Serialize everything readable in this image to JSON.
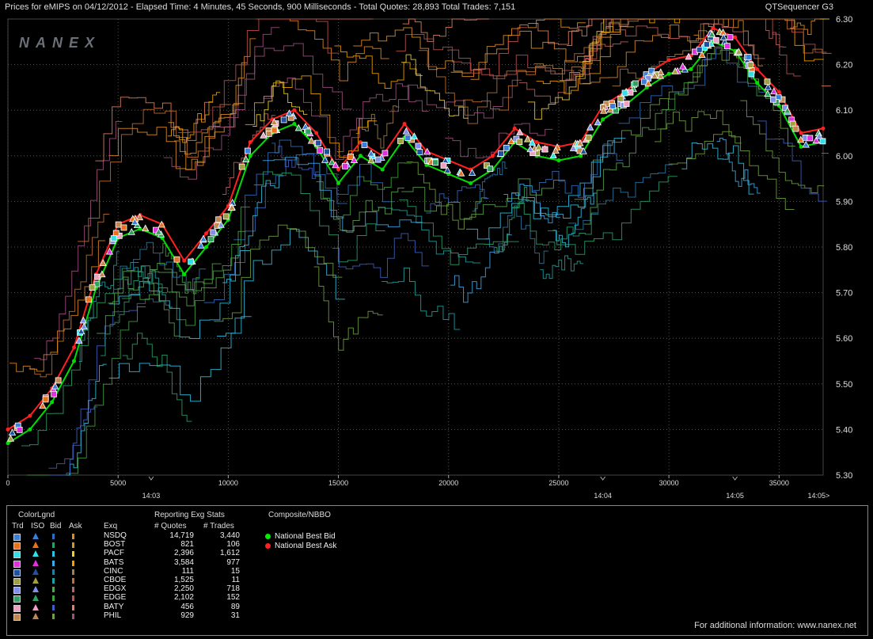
{
  "header": {
    "title": "Prices for  eMIPS  on  04/12/2012  -  Elapsed Time: 4 Minutes, 45 Seconds, 900 Milliseconds  -  Total Quotes: 28,893  Total Trades: 7,151",
    "app": "QTSequencer G3"
  },
  "watermark": "NANEX",
  "chart_data": {
    "type": "line",
    "title": "",
    "xlabel": "",
    "ylabel": "",
    "xlim": [
      0,
      37000
    ],
    "ylim": [
      5.3,
      6.3
    ],
    "x_ticks": [
      "0",
      "5000",
      "10000",
      "15000",
      "20000",
      "25000",
      "30000",
      "35000"
    ],
    "x_tick_values": [
      0,
      5000,
      10000,
      15000,
      20000,
      25000,
      30000,
      35000
    ],
    "y_ticks": [
      "6.30",
      "6.20",
      "6.10",
      "6.00",
      "5.90",
      "5.80",
      "5.70",
      "5.60",
      "5.50",
      "5.40",
      "5.30"
    ],
    "y_tick_values": [
      6.3,
      6.2,
      6.1,
      6.0,
      5.9,
      5.8,
      5.7,
      5.6,
      5.5,
      5.4,
      5.3
    ],
    "time_markers": [
      {
        "label": "14:03",
        "x": 6500
      },
      {
        "label": "14:04",
        "x": 27000
      },
      {
        "label": "14:05",
        "x": 33000
      },
      {
        "label": "14:05>",
        "x": 36800
      }
    ],
    "grid": true,
    "series": [
      {
        "name": "National Best Bid",
        "color": "#00dd00",
        "x": [
          0,
          1000,
          2000,
          3000,
          4000,
          5000,
          6000,
          7000,
          8000,
          9000,
          10000,
          11000,
          12000,
          13000,
          14000,
          15000,
          16000,
          17000,
          18000,
          19000,
          20000,
          21000,
          22000,
          23000,
          24000,
          25000,
          26000,
          27000,
          28000,
          29000,
          30000,
          31000,
          32000,
          33000,
          34000,
          35000,
          36000,
          37000
        ],
        "values": [
          5.37,
          5.4,
          5.46,
          5.55,
          5.71,
          5.82,
          5.84,
          5.82,
          5.74,
          5.8,
          5.86,
          6.0,
          6.05,
          6.07,
          6.02,
          5.94,
          6.0,
          5.97,
          6.04,
          5.98,
          5.96,
          5.94,
          5.97,
          6.03,
          6.0,
          5.99,
          6.0,
          6.08,
          6.11,
          6.15,
          6.18,
          6.19,
          6.25,
          6.23,
          6.16,
          6.11,
          6.02,
          6.03
        ]
      },
      {
        "name": "National Best Ask",
        "color": "#ff2020",
        "x": [
          0,
          1000,
          2000,
          3000,
          4000,
          5000,
          6000,
          7000,
          8000,
          9000,
          10000,
          11000,
          12000,
          13000,
          14000,
          15000,
          16000,
          17000,
          18000,
          19000,
          20000,
          21000,
          22000,
          23000,
          24000,
          25000,
          26000,
          27000,
          28000,
          29000,
          30000,
          31000,
          32000,
          33000,
          34000,
          35000,
          36000,
          37000
        ],
        "values": [
          5.4,
          5.43,
          5.49,
          5.58,
          5.74,
          5.85,
          5.87,
          5.85,
          5.77,
          5.83,
          5.89,
          6.03,
          6.08,
          6.1,
          6.05,
          5.97,
          6.03,
          6.0,
          6.07,
          6.01,
          5.99,
          5.97,
          6.0,
          6.06,
          6.03,
          6.02,
          6.03,
          6.11,
          6.14,
          6.18,
          6.21,
          6.22,
          6.28,
          6.26,
          6.19,
          6.14,
          6.05,
          6.06
        ]
      }
    ]
  },
  "legend": {
    "colorlgnd_title": "ColorLgnd",
    "stats_title": "Reporting Exg Stats",
    "composite_title": "Composite/NBBO",
    "col_trd": "Trd",
    "col_iso": "ISO",
    "col_bid": "Bid",
    "col_ask": "Ask",
    "col_exq": "Exq",
    "col_quotes": "# Quotes",
    "col_trades": "# Trades",
    "exchanges": [
      {
        "name": "NSDQ",
        "quotes": "14,719",
        "trades": "3,440",
        "trd": "#3a7fd8",
        "iso": "#3a7fd8",
        "bid": "#2f6fc0",
        "ask": "#e08a20"
      },
      {
        "name": "BOST",
        "quotes": "821",
        "trades": "106",
        "trd": "#e8701e",
        "iso": "#e8701e",
        "bid": "#2aa06a",
        "ask": "#e0902a"
      },
      {
        "name": "PACF",
        "quotes": "2,396",
        "trades": "1,612",
        "trd": "#30e0e8",
        "iso": "#30e0e8",
        "bid": "#30c0e0",
        "ask": "#f0d030"
      },
      {
        "name": "BATS",
        "quotes": "3,584",
        "trades": "977",
        "trd": "#e030e0",
        "iso": "#e030e0",
        "bid": "#40a8e8",
        "ask": "#f0a000"
      },
      {
        "name": "CINC",
        "quotes": "111",
        "trades": "15",
        "trd": "#2050a0",
        "iso": "#2050a0",
        "bid": "#2a7aa8",
        "ask": "#a08050"
      },
      {
        "name": "CBOE",
        "quotes": "1,525",
        "trades": "11",
        "trd": "#a0a040",
        "iso": "#a0a040",
        "bid": "#20a0a0",
        "ask": "#c07030"
      },
      {
        "name": "EDGX",
        "quotes": "2,250",
        "trades": "718",
        "trd": "#8090e8",
        "iso": "#8090e8",
        "bid": "#5aa050",
        "ask": "#c06060"
      },
      {
        "name": "EDGE",
        "quotes": "2,102",
        "trades": "152",
        "trd": "#30a060",
        "iso": "#30a060",
        "bid": "#40a040",
        "ask": "#c05050"
      },
      {
        "name": "BATY",
        "quotes": "456",
        "trades": "89",
        "trd": "#f0a0c0",
        "iso": "#f0a0c0",
        "bid": "#4060c0",
        "ask": "#e08060"
      },
      {
        "name": "PHIL",
        "quotes": "929",
        "trades": "31",
        "trd": "#c08850",
        "iso": "#c08850",
        "bid": "#70a040",
        "ask": "#a05080"
      }
    ],
    "nbbo": [
      {
        "label": "National Best Bid",
        "color": "#00ee00"
      },
      {
        "label": "National Best Ask",
        "color": "#ff2020"
      }
    ],
    "info": "For additional information: www.nanex.net"
  }
}
